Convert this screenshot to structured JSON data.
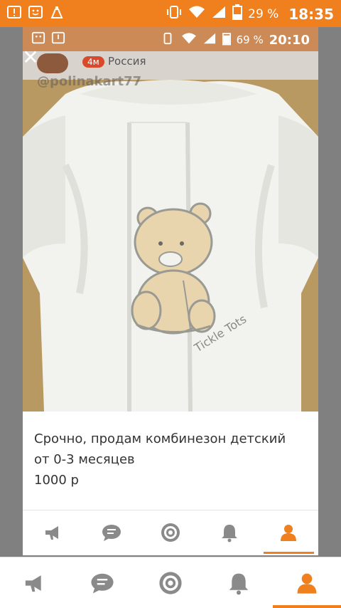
{
  "status_bar": {
    "battery_percent": "29 %",
    "time": "18:35",
    "notification_icons": [
      "alert-icon",
      "face-icon",
      "cleaner-icon"
    ]
  },
  "inner_status_bar": {
    "battery_percent": "69 %",
    "time": "20:10"
  },
  "post": {
    "age_badge": "4м",
    "country": "Россия",
    "username": "@polinakart77",
    "description_line1": "Срочно, продам комбинезон детский",
    "description_line2": "от 0-3 месяцев",
    "price": "1000 р"
  },
  "photo": {
    "embroidery_text": "Tickle Tots"
  },
  "tabs": [
    {
      "name": "feed",
      "icon": "megaphone-icon"
    },
    {
      "name": "messages",
      "icon": "chat-icon"
    },
    {
      "name": "discover",
      "icon": "target-icon"
    },
    {
      "name": "notifications",
      "icon": "bell-icon"
    },
    {
      "name": "profile",
      "icon": "person-icon",
      "active": true
    }
  ],
  "colors": {
    "accent": "#f07f1e",
    "icon_inactive": "#8a8a8a"
  }
}
